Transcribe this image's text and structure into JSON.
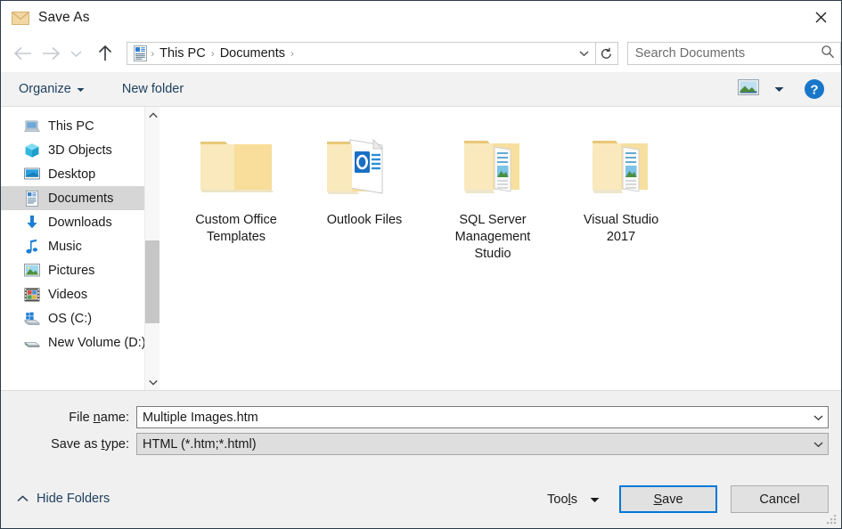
{
  "window": {
    "title": "Save As",
    "title_icon": "envelope-icon",
    "close_label": "✕"
  },
  "nav": {
    "back": "back-arrow",
    "forward": "forward-arrow",
    "recent": "recent-locations-chevron",
    "up": "up-arrow",
    "refresh": "refresh-icon",
    "address_icon": "documents-folder-icon",
    "breadcrumbs": [
      "This PC",
      "Documents"
    ],
    "separator": "›",
    "dropdown": "chevron-down-icon"
  },
  "search": {
    "placeholder": "Search Documents",
    "value": "",
    "icon": "search-icon"
  },
  "toolbar": {
    "organize_label": "Organize",
    "organize_caret": "▾",
    "new_folder_label": "New folder",
    "view_icon": "view-thumbnail-icon",
    "view_caret": "▾",
    "help_icon": "help-question-icon",
    "help_label": "?"
  },
  "sidebar": {
    "items": [
      {
        "label": "This PC",
        "icon": "this-pc-icon",
        "selected": false
      },
      {
        "label": "3D Objects",
        "icon": "3d-objects-icon",
        "selected": false
      },
      {
        "label": "Desktop",
        "icon": "desktop-icon",
        "selected": false
      },
      {
        "label": "Documents",
        "icon": "documents-icon",
        "selected": true
      },
      {
        "label": "Downloads",
        "icon": "downloads-icon",
        "selected": false
      },
      {
        "label": "Music",
        "icon": "music-icon",
        "selected": false
      },
      {
        "label": "Pictures",
        "icon": "pictures-icon",
        "selected": false
      },
      {
        "label": "Videos",
        "icon": "videos-icon",
        "selected": false
      },
      {
        "label": "OS (C:)",
        "icon": "drive-os-icon",
        "selected": false
      },
      {
        "label": "New Volume (D:)",
        "icon": "drive-icon",
        "selected": false
      }
    ],
    "scroll_up": "chevron-up-icon",
    "scroll_down": "chevron-down-icon"
  },
  "files": [
    {
      "name": "Custom Office Templates",
      "icon": "folder-plain-icon"
    },
    {
      "name": "Outlook Files",
      "icon": "folder-outlook-icon"
    },
    {
      "name": "SQL Server Management Studio",
      "icon": "folder-open-docs-icon"
    },
    {
      "name": "Visual Studio 2017",
      "icon": "folder-open-docs-icon"
    }
  ],
  "form": {
    "filename_label_pre": "File ",
    "filename_label_accel": "n",
    "filename_label_post": "ame:",
    "filename_value": "Multiple Images.htm",
    "filetype_label_pre": "Save as ",
    "filetype_label_accel": "t",
    "filetype_label_post": "ype:",
    "filetype_value": "HTML (*.htm;*.html)",
    "combo_arrow": "chevron-down-icon"
  },
  "footer": {
    "hide_folders_label": "Hide Folders",
    "hide_folders_icon": "chevron-up-icon",
    "tools_label_pre": "Too",
    "tools_label_accel": "l",
    "tools_label_post": "s",
    "tools_caret": "▾",
    "save_label_pre": "",
    "save_label_accel": "S",
    "save_label_post": "ave",
    "cancel_label": "Cancel",
    "resize_grip": "resize-grip-icon"
  },
  "colors": {
    "accent": "#0078d7",
    "window_border": "#2b3a4a",
    "toolbar_bg": "#f2f2f2",
    "form_bg": "#f0f0f0",
    "selection_bg": "#d6d6d6",
    "link_text": "#1c3f5e",
    "folder_yellow": "#fbdd92"
  }
}
